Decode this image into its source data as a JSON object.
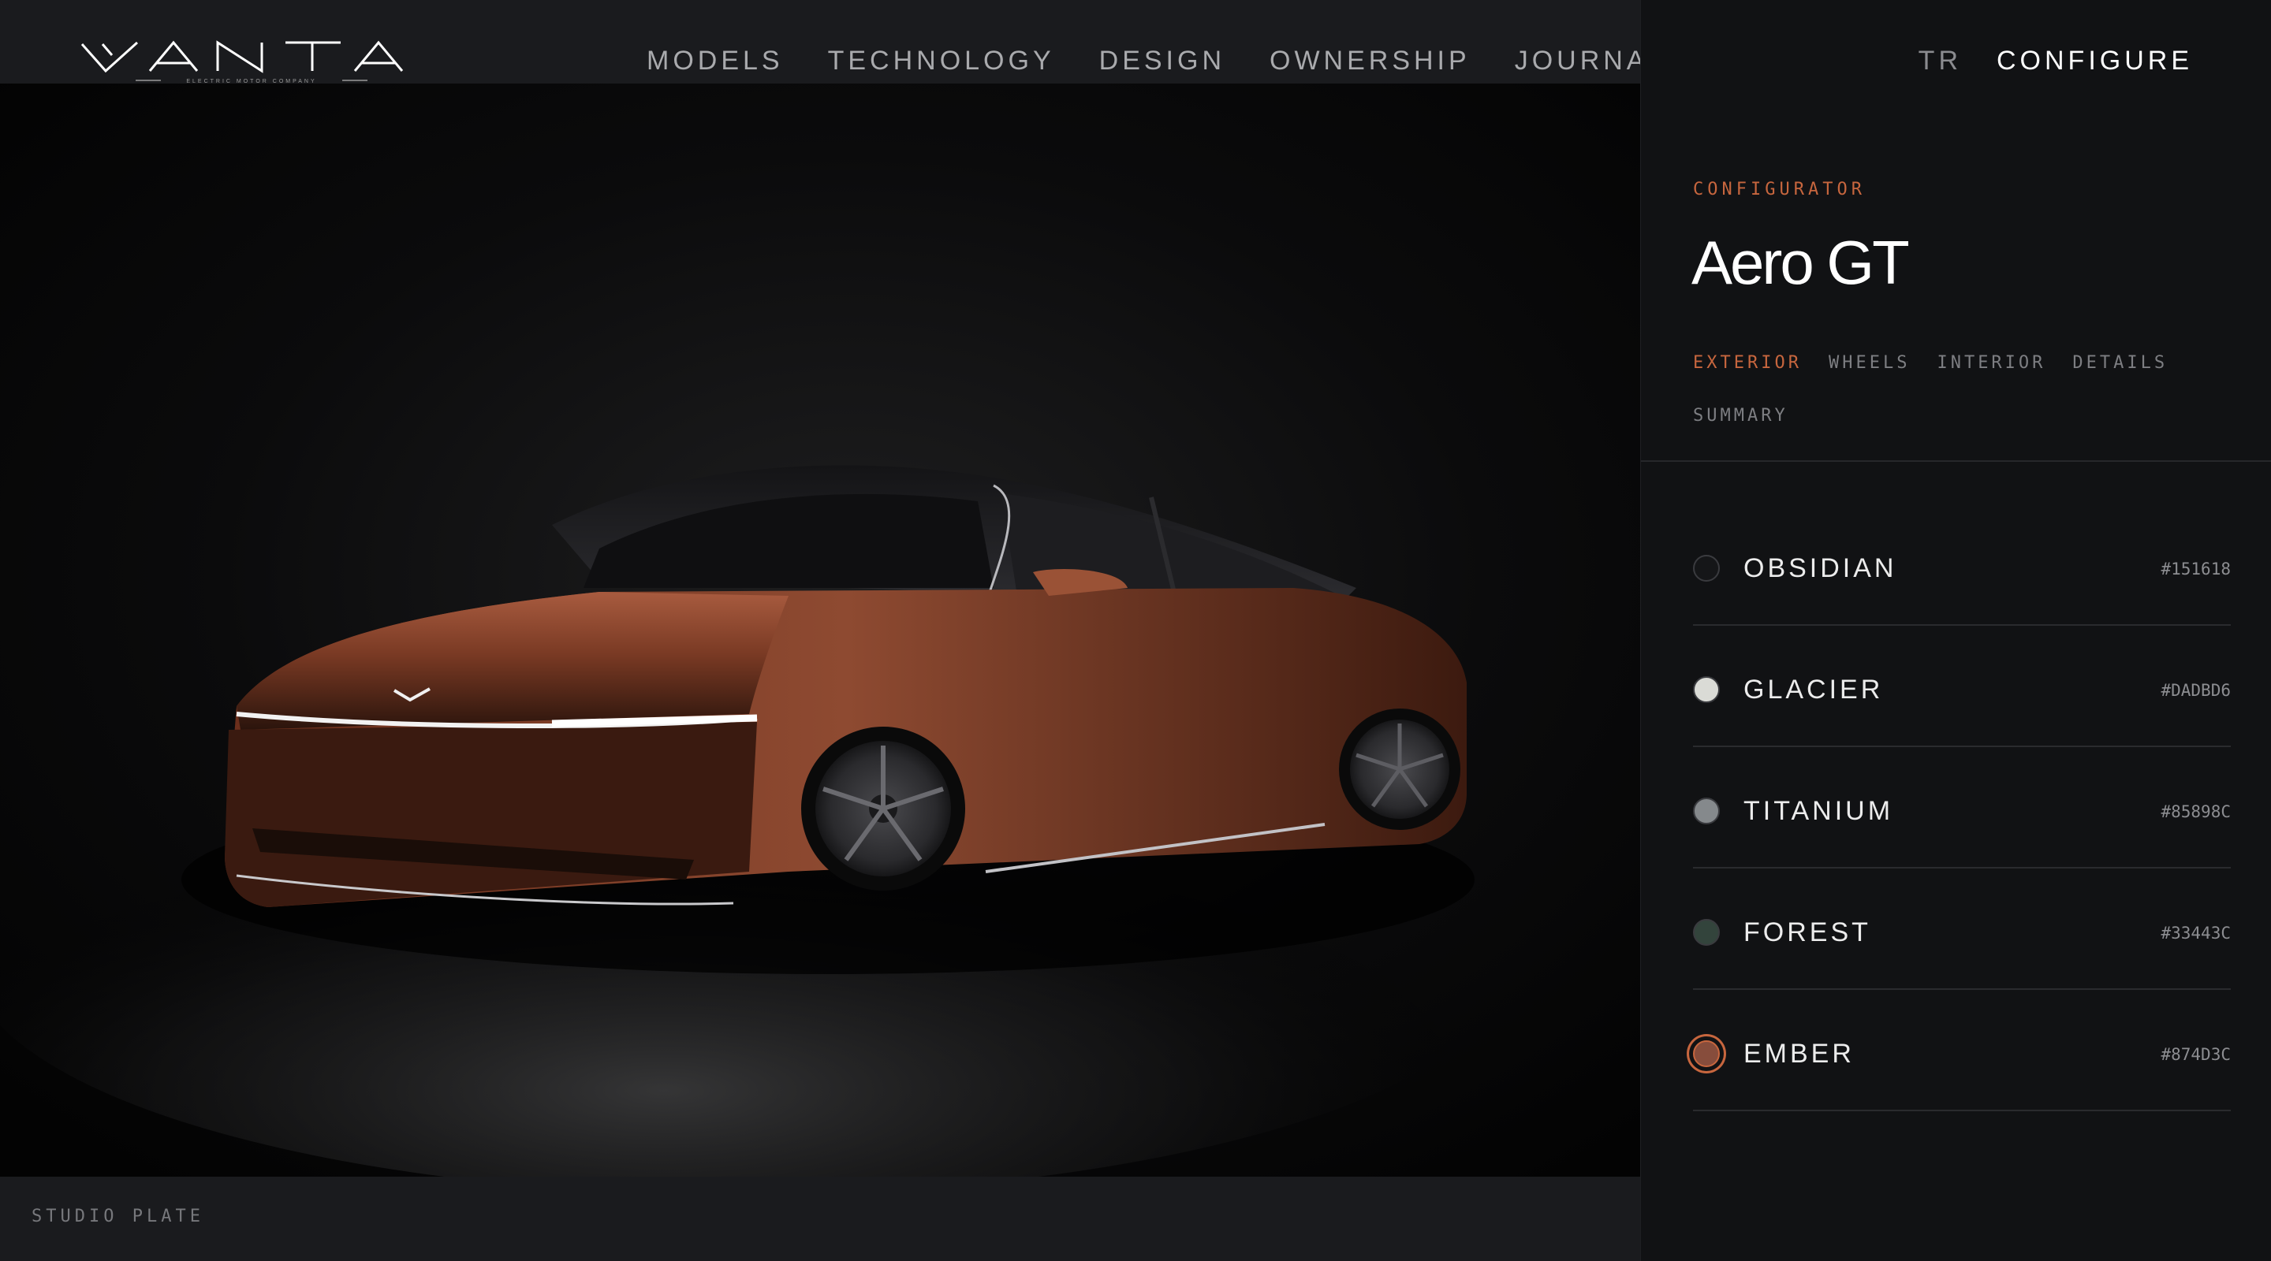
{
  "brand": {
    "name": "VANTA",
    "tagline": "ELECTRIC MOTOR COMPANY"
  },
  "nav": {
    "items": [
      {
        "label": "MODELS"
      },
      {
        "label": "TECHNOLOGY"
      },
      {
        "label": "DESIGN"
      },
      {
        "label": "OWNERSHIP"
      },
      {
        "label": "JOURNAL"
      }
    ]
  },
  "utility": {
    "language": "TR",
    "cta": "CONFIGURE"
  },
  "hero": {
    "caption": "STUDIO PLATE",
    "car_color": "#874D3C"
  },
  "configurator": {
    "eyebrow": "CONFIGURATOR",
    "model": "Aero GT",
    "steps": [
      {
        "label": "EXTERIOR",
        "active": true
      },
      {
        "label": "WHEELS",
        "active": false
      },
      {
        "label": "INTERIOR",
        "active": false
      },
      {
        "label": "DETAILS",
        "active": false
      },
      {
        "label": "SUMMARY",
        "active": false
      }
    ],
    "colors": [
      {
        "name": "OBSIDIAN",
        "hex": "#151618",
        "selected": false
      },
      {
        "name": "GLACIER",
        "hex": "#DADBD6",
        "selected": false
      },
      {
        "name": "TITANIUM",
        "hex": "#85898C",
        "selected": false
      },
      {
        "name": "FOREST",
        "hex": "#33443C",
        "selected": false
      },
      {
        "name": "EMBER",
        "hex": "#874D3C",
        "selected": true
      }
    ]
  },
  "theme": {
    "accent": "#C7663E",
    "background": "#1A1B1E",
    "panel": "#111214"
  }
}
